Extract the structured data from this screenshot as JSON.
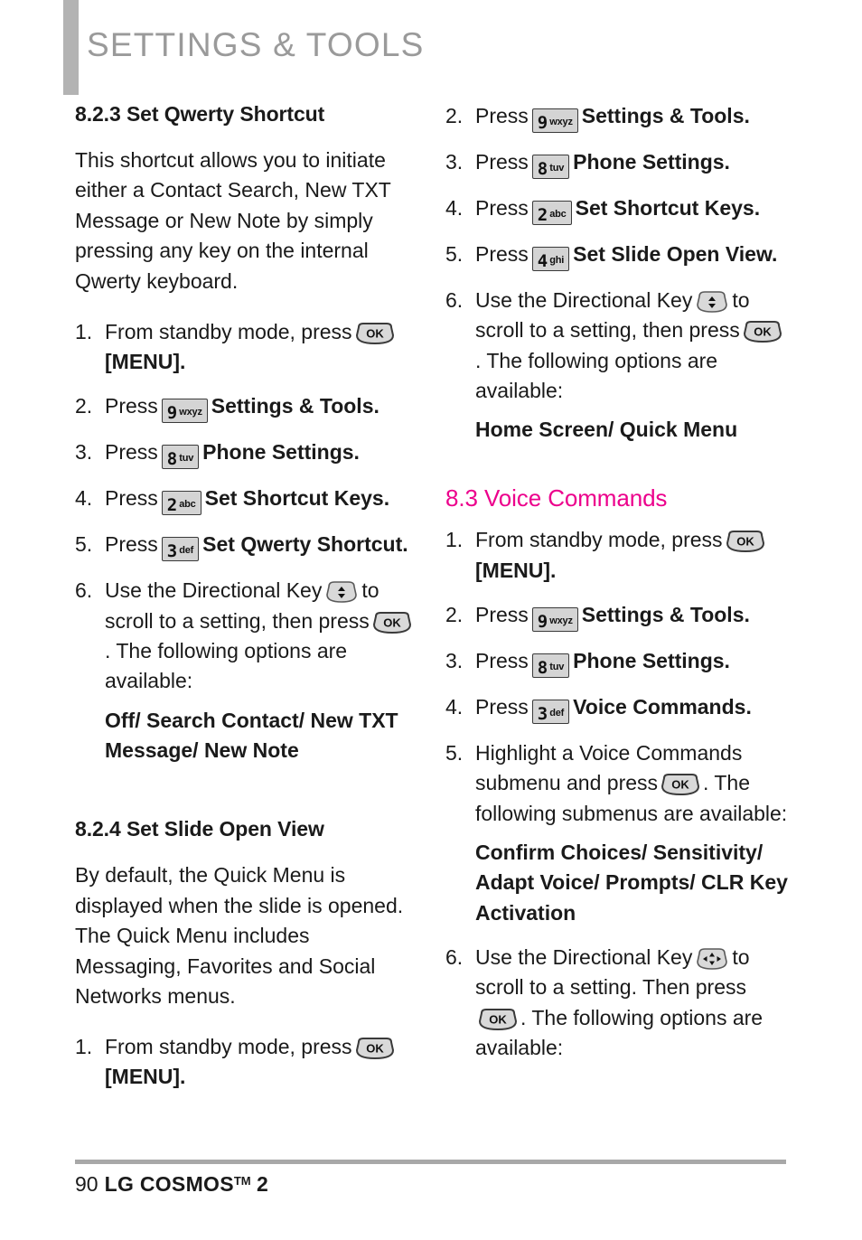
{
  "header": {
    "title": "SETTINGS & TOOLS",
    "accent_bar_color": "#b3b3b3",
    "title_color": "#9a9a9a"
  },
  "colors": {
    "magenta": "#ec008c",
    "body_text": "#1a1a1a",
    "keycap_fill": "#d4d4d4"
  },
  "left_column": {
    "section_8_2_3": {
      "heading": "8.2.3 Set Qwerty Shortcut",
      "paragraph": "This shortcut allows you to initiate either a Contact Search, New TXT Message or New Note by simply pressing any key on the internal Qwerty keyboard.",
      "steps": [
        {
          "num": "1.",
          "before": "From standby mode, press",
          "key": "ok-key",
          "after": "",
          "bold_after": "[MENU]."
        },
        {
          "num": "2.",
          "before": "Press",
          "key": "9",
          "key_letters": "wxyz",
          "bold_after": "Settings & Tools."
        },
        {
          "num": "3.",
          "before": "Press",
          "key": "8",
          "key_letters": "tuv",
          "bold_after": "Phone Settings."
        },
        {
          "num": "4.",
          "before": "Press",
          "key": "2",
          "key_letters": "abc",
          "bold_after": "Set Shortcut Keys."
        },
        {
          "num": "5.",
          "before": "Press",
          "key": "3",
          "key_letters": "def",
          "bold_after": "Set Qwerty Shortcut."
        },
        {
          "num": "6.",
          "before": "Use the Directional Key",
          "key": "dir-updown-key",
          "mid": "to scroll to a setting, then press",
          "key2": "ok-key",
          "after": ". The following options are available:"
        }
      ],
      "options": "Off/ Search Contact/ New TXT Message/ New Note"
    },
    "section_8_2_4": {
      "heading": "8.2.4 Set Slide Open View",
      "paragraph": "By default, the Quick Menu is displayed when the slide is opened. The Quick Menu includes Messaging, Favorites and Social Networks menus.",
      "steps": [
        {
          "num": "1.",
          "before": "From standby mode, press",
          "key": "ok-key",
          "bold_after": "[MENU]."
        }
      ]
    }
  },
  "right_column": {
    "section_8_2_4_cont": {
      "steps": [
        {
          "num": "2.",
          "before": "Press",
          "key": "9",
          "key_letters": "wxyz",
          "bold_after": "Settings & Tools."
        },
        {
          "num": "3.",
          "before": "Press",
          "key": "8",
          "key_letters": "tuv",
          "bold_after": "Phone Settings."
        },
        {
          "num": "4.",
          "before": "Press",
          "key": "2",
          "key_letters": "abc",
          "bold_after": "Set Shortcut Keys."
        },
        {
          "num": "5.",
          "before": "Press",
          "key": "4",
          "key_letters": "ghi",
          "bold_after": "Set Slide Open View."
        },
        {
          "num": "6.",
          "before": "Use the Directional Key",
          "key": "dir-updown-key",
          "mid": "to scroll to a setting, then press",
          "key2": "ok-key",
          "after": ". The following options are available:"
        }
      ],
      "options": "Home Screen/ Quick Menu"
    },
    "section_8_3": {
      "heading": "8.3 Voice Commands",
      "steps": [
        {
          "num": "1.",
          "before": "From standby mode, press",
          "key": "ok-key",
          "bold_after": "[MENU]."
        },
        {
          "num": "2.",
          "before": "Press",
          "key": "9",
          "key_letters": "wxyz",
          "bold_after": "Settings & Tools."
        },
        {
          "num": "3.",
          "before": "Press",
          "key": "8",
          "key_letters": "tuv",
          "bold_after": "Phone Settings."
        },
        {
          "num": "4.",
          "before": "Press",
          "key": "3",
          "key_letters": "def",
          "bold_after": "Voice Commands."
        },
        {
          "num": "5.",
          "before": "Highlight a Voice Commands submenu and press",
          "key": "ok-key",
          "after": ". The following submenus are available:"
        },
        {
          "num": "6.",
          "before": "Use the Directional Key",
          "key": "dir-4way-key",
          "mid": "to scroll to a setting. Then press",
          "key2": "ok-key",
          "after": ". The following options are available:"
        }
      ],
      "submenus": "Confirm Choices/ Sensitivity/ Adapt Voice/ Prompts/ CLR Key Activation"
    }
  },
  "footer": {
    "page_number": "90",
    "brand": "LG COSMOS",
    "trademark": "TM",
    "model": "2"
  }
}
